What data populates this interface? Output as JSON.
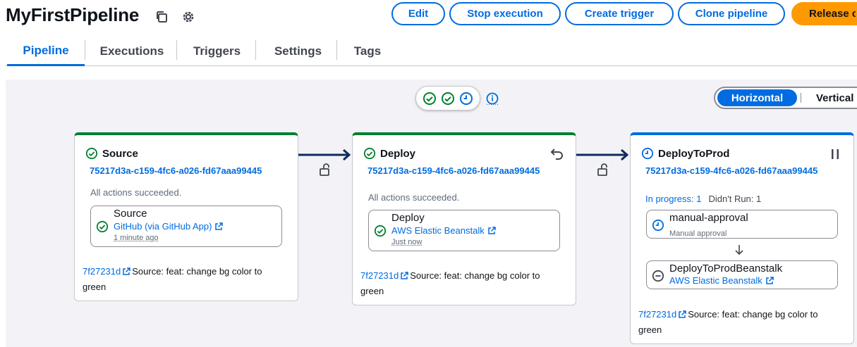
{
  "header": {
    "title": "MyFirstPipeline",
    "copy_icon": "copy-icon",
    "settings_icon": "gear-icon",
    "buttons": {
      "edit": "Edit",
      "stop": "Stop execution",
      "trigger": "Create trigger",
      "clone": "Clone pipeline",
      "release": "Release change"
    }
  },
  "tabs": [
    "Pipeline",
    "Executions",
    "Triggers",
    "Settings",
    "Tags"
  ],
  "active_tab": "Pipeline",
  "orientation": {
    "horizontal": "Horizontal",
    "vertical": "Vertical"
  },
  "colors": {
    "success": "#00802f",
    "in_progress": "#006ce0",
    "link": "#006ce0",
    "release_button": "#ff9900",
    "canvas": "#f3f3f7"
  },
  "stages": [
    {
      "name": "Source",
      "status": "succeeded",
      "execution_id": "75217d3a-c159-4fc6-a026-fd67aaa99445",
      "message": "All actions succeeded.",
      "action": {
        "name": "Source",
        "provider": "GitHub (via GitHub App)",
        "time": "1 minute ago",
        "status": "succeeded"
      },
      "commit": {
        "id": "7f27231d",
        "message": "Source: feat: change bg color to green"
      }
    },
    {
      "name": "Deploy",
      "status": "succeeded",
      "execution_id": "75217d3a-c159-4fc6-a026-fd67aaa99445",
      "message": "All actions succeeded.",
      "action": {
        "name": "Deploy",
        "provider": "AWS Elastic Beanstalk",
        "time": "Just now",
        "status": "succeeded"
      },
      "commit": {
        "id": "7f27231d",
        "message": "Source: feat: change bg color to green"
      }
    },
    {
      "name": "DeployToProd",
      "status": "in_progress",
      "execution_id": "75217d3a-c159-4fc6-a026-fd67aaa99445",
      "in_progress": "In progress: 1",
      "didnt_run": "Didn't Run: 1",
      "actions": [
        {
          "name": "manual-approval",
          "subtitle": "Manual approval",
          "status": "in_progress"
        },
        {
          "name": "DeployToProdBeanstalk",
          "provider": "AWS Elastic Beanstalk",
          "status": "didnt_run"
        }
      ],
      "commit": {
        "id": "7f27231d",
        "message": "Source: feat: change bg color to green"
      }
    }
  ]
}
